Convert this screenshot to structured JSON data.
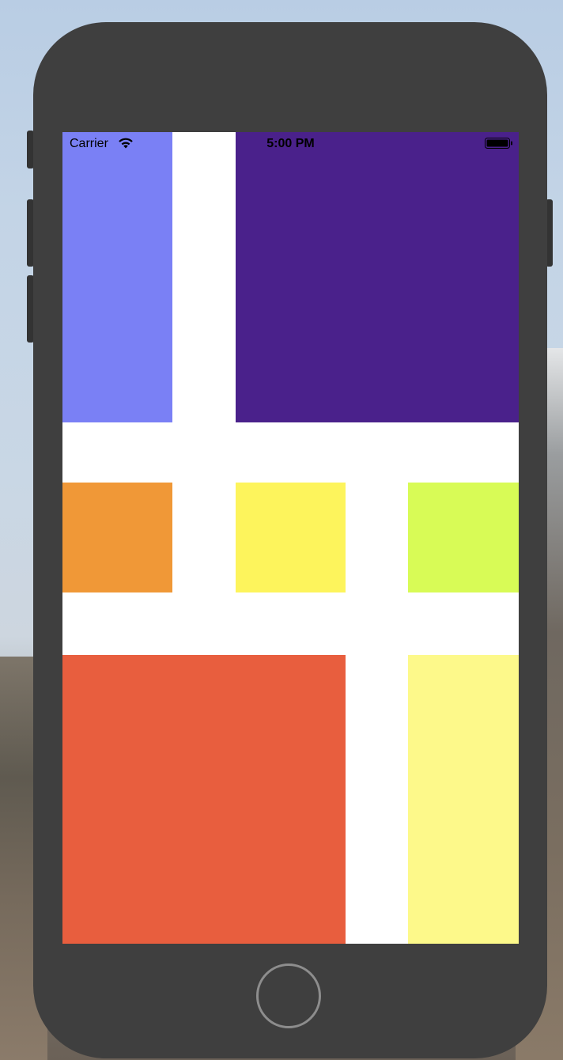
{
  "status_bar": {
    "carrier": "Carrier",
    "time": "5:00 PM"
  },
  "icons": {
    "wifi": "wifi-icon",
    "battery": "battery-icon"
  },
  "tiles": [
    {
      "name": "tile-periwinkle",
      "color": "#7a80f5"
    },
    {
      "name": "tile-purple",
      "color": "#4a218b"
    },
    {
      "name": "tile-orange",
      "color": "#f09837"
    },
    {
      "name": "tile-yellow",
      "color": "#fdf45c"
    },
    {
      "name": "tile-lime",
      "color": "#d8fb56"
    },
    {
      "name": "tile-red",
      "color": "#e85e3e"
    },
    {
      "name": "tile-pale-yellow",
      "color": "#fdf98a"
    }
  ]
}
